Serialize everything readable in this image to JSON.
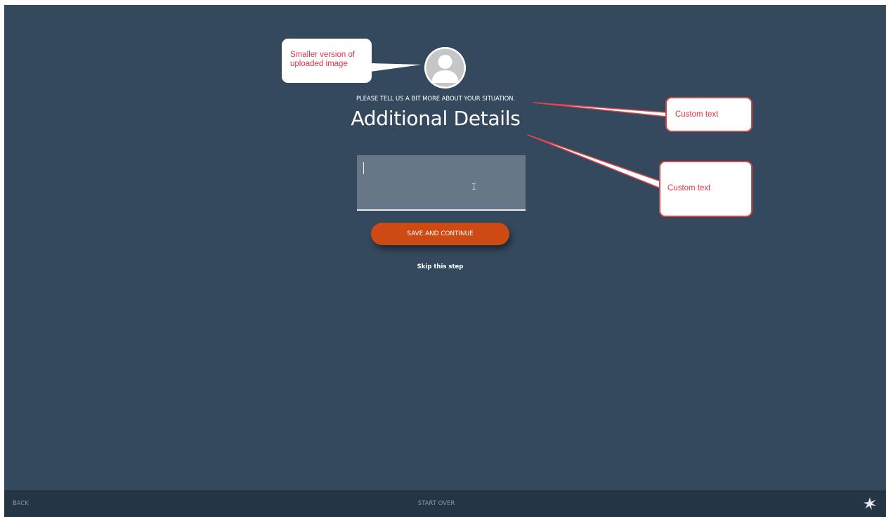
{
  "form": {
    "subtitle": "PLEASE TELL US A BIT MORE ABOUT YOUR SITUATION.",
    "title": "Additional Details",
    "details_value": "",
    "save_label": "SAVE AND CONTINUE",
    "skip_label": "Skip this step"
  },
  "footer": {
    "back_label": "BACK",
    "start_over_label": "START OVER",
    "logo_icon": "star-burst-icon"
  },
  "annotations": {
    "avatar_note": "Smaller version of uploaded image",
    "subtitle_note": "Custom text",
    "title_note": "Custom text"
  },
  "colors": {
    "background": "#35495e",
    "footer": "#263545",
    "accent_button": "#cd4a15",
    "input_fill": "#687788",
    "annotation_text": "#e4343f"
  }
}
